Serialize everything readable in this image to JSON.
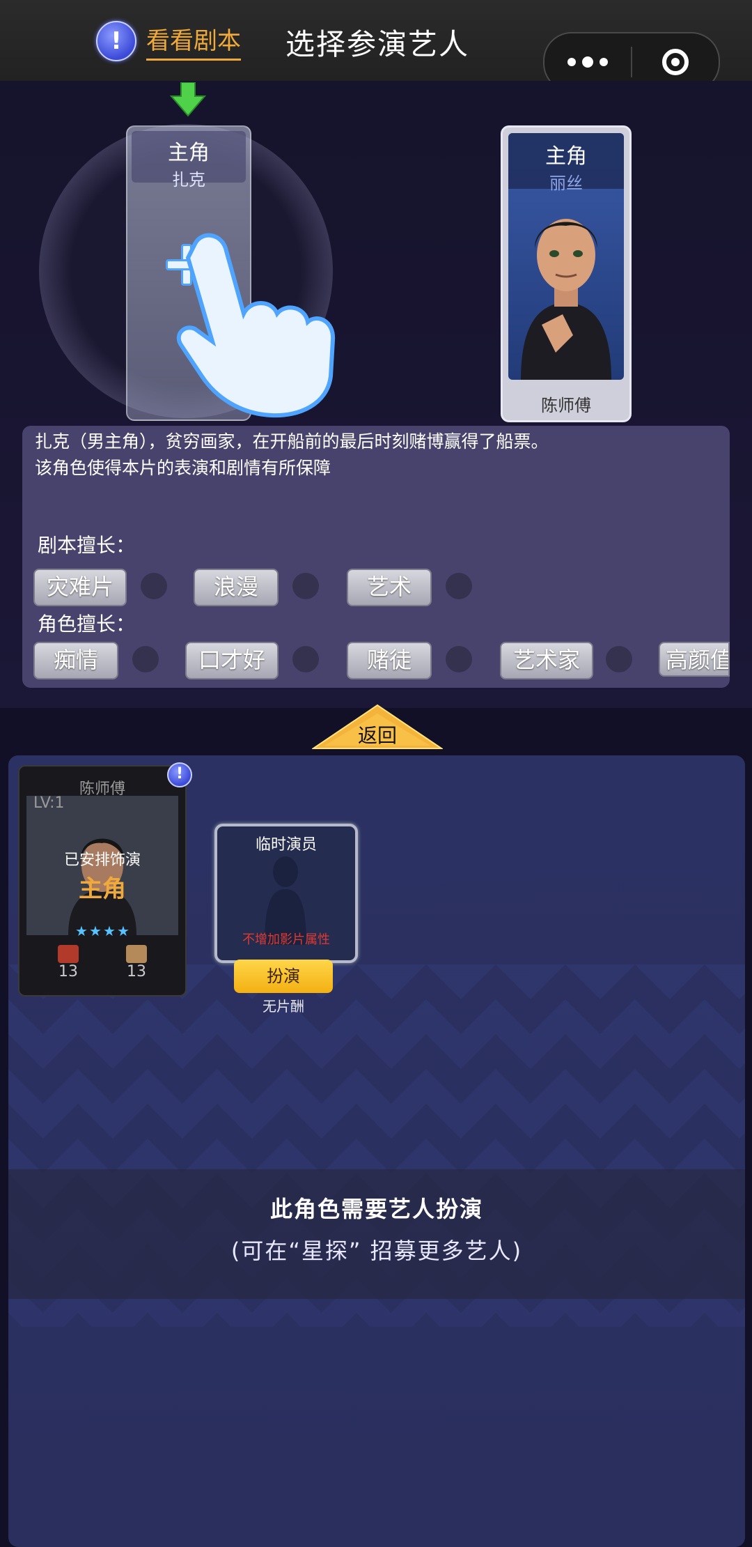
{
  "header": {
    "script_label": "看看剧本",
    "title": "选择参演艺人"
  },
  "slot": {
    "role_type": "主角",
    "role_name": "扎克"
  },
  "actor": {
    "role_type": "主角",
    "role_name": "丽丝",
    "name": "陈师傅"
  },
  "description": {
    "line1": "扎克（男主角），贫穷画家，在开船前的最后时刻赌博赢得了船票。",
    "line2": "该角色使得本片的表演和剧情有所保障",
    "script_title": "剧本擅长：",
    "script_tags": [
      "灾难片",
      "浪漫",
      "艺术"
    ],
    "role_title": "角色擅长：",
    "role_tags": [
      "痴情",
      "口才好",
      "赌徒",
      "艺术家",
      "高颜值"
    ]
  },
  "back_label": "返回",
  "artist": {
    "name": "陈师傅",
    "level": "LV:1",
    "arranged": "已安排饰演",
    "role": "主角",
    "stars": 4,
    "stat1": "13",
    "stat2": "13",
    "badge": "!"
  },
  "extra": {
    "title": "临时演员",
    "note": "不增加影片属性",
    "button": "扮演",
    "fee": "无片酬"
  },
  "notice": {
    "line1": "此角色需要艺人扮演",
    "line2": "(可在“星探” 招募更多艺人)"
  },
  "colors": {
    "accent": "#f0a93b",
    "panel": "#4c4872",
    "bottom_panel": "#2b3162",
    "button": "#f3b012"
  }
}
